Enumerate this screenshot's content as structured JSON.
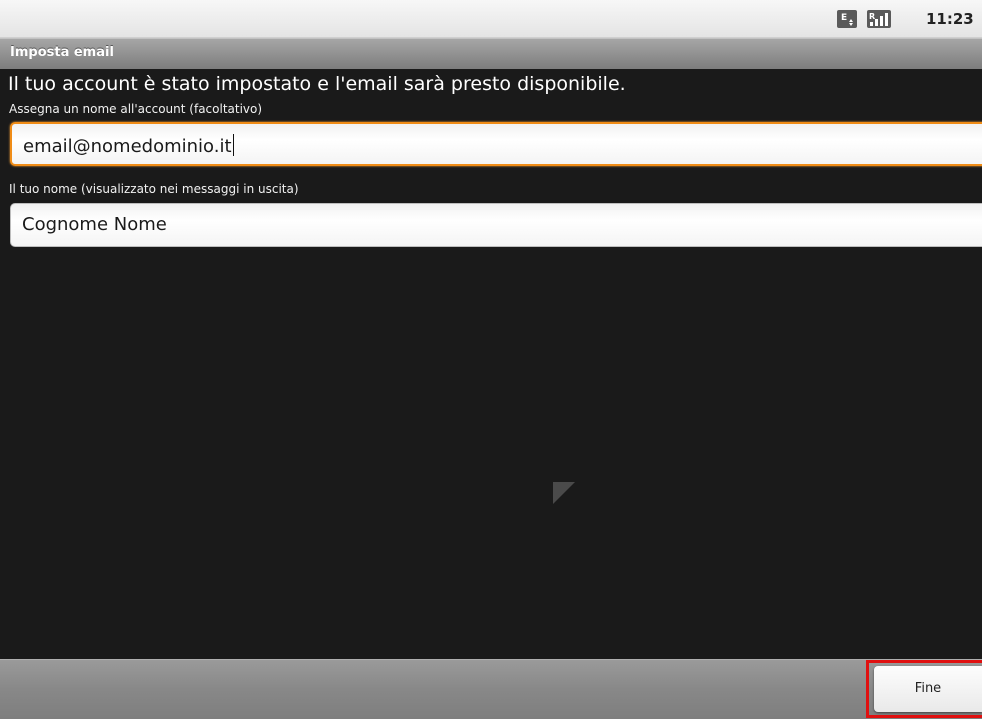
{
  "status_bar": {
    "time": "11:23",
    "icons": [
      "sim-e-icon",
      "signal-roaming-icon"
    ]
  },
  "title_bar": {
    "title": "Imposta email"
  },
  "content": {
    "headline": "Il tuo account è stato impostato e l'email sarà presto disponibile.",
    "account_name_label": "Assegna un nome all'account (facoltativo)",
    "account_name_value": "email@nomedominio.it",
    "your_name_label": "Il tuo nome (visualizzato nei messaggi in uscita)",
    "your_name_value": "Cognome Nome"
  },
  "bottom_bar": {
    "done_label": "Fine"
  },
  "colors": {
    "focus_border": "#f08c16",
    "highlight": "#e01010",
    "background": "#1a1a1a"
  }
}
